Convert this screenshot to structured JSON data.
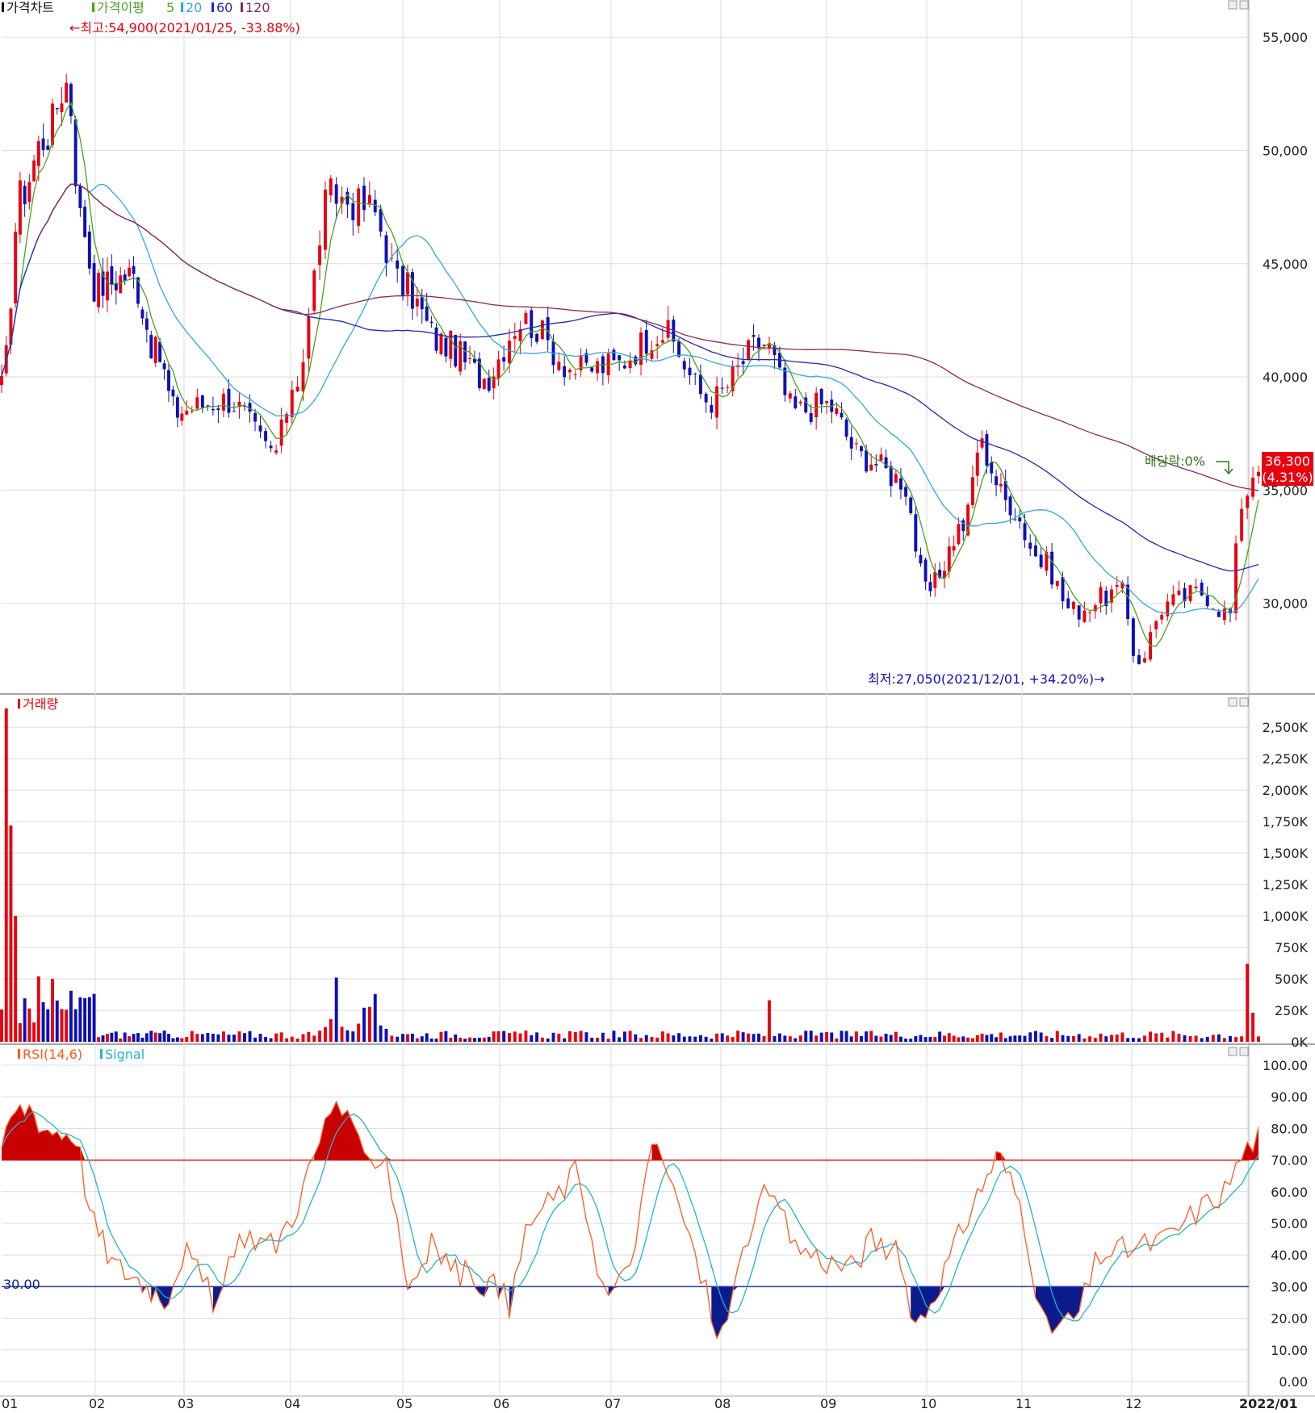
{
  "colors": {
    "up": "#e8000f",
    "down": "#0d10b4",
    "ma5": "#4aa21e",
    "ma20": "#33a6df",
    "ma60": "#2228b8",
    "ma120": "#8a2a54",
    "rsi": "#ff5a1f",
    "signal": "#23b4c8",
    "over": "#c80000",
    "under": "#0b1b8c",
    "grid": "#dcdcdc",
    "axis": "#777777",
    "text": "#222222"
  },
  "months": [
    "01",
    "02",
    "03",
    "04",
    "05",
    "06",
    "07",
    "08",
    "09",
    "10",
    "11",
    "12",
    "2022/01"
  ],
  "price_panel": {
    "legend": {
      "chart": "가격차트",
      "ma": "가격이평",
      "p5": "5",
      "p20": "20",
      "p60": "60",
      "p120": "120"
    },
    "high_label": "←최고:54,900(2021/01/25, -33.88%)",
    "low_label": "최저:27,050(2021/12/01, +34.20%)→",
    "dividend_label": "배당락:0%",
    "last_price": "36,300",
    "last_change": "(4.31%)",
    "ticks": [
      "55,000",
      "50,000",
      "45,000",
      "40,000",
      "35,000",
      "30,000"
    ]
  },
  "volume_panel": {
    "legend": "거래량",
    "ticks": [
      "2,500K",
      "2,250K",
      "2,000K",
      "1,750K",
      "1,500K",
      "1,250K",
      "1,000K",
      "750K",
      "500K",
      "250K",
      "0K"
    ]
  },
  "rsi_panel": {
    "legend_rsi": "RSI(14,6)",
    "legend_signal": "Signal",
    "ticks": [
      "100.00",
      "90.00",
      "80.00",
      "70.00",
      "60.00",
      "50.00",
      "40.00",
      "30.00",
      "20.00",
      "10.00",
      "0.00"
    ],
    "lower_label": "30.00"
  },
  "chart_data": [
    {
      "type": "candlestick",
      "title": "가격차트",
      "x_axis": "month",
      "ylim": [
        26000,
        56500
      ],
      "high": {
        "value": 54900,
        "date": "2021/01/25",
        "change_pct": -33.88
      },
      "low": {
        "value": 27050,
        "date": "2021/12/01",
        "change_pct": 34.2
      },
      "last": {
        "value": 36300,
        "change_pct": 4.31
      },
      "close_path": [
        {
          "month": 1.0,
          "close": 39500
        },
        {
          "month": 1.2,
          "close": 48000
        },
        {
          "month": 1.45,
          "close": 50500
        },
        {
          "month": 1.7,
          "close": 53000
        },
        {
          "month": 1.85,
          "close": 47000
        },
        {
          "month": 2.0,
          "close": 44000
        },
        {
          "month": 2.4,
          "close": 44500
        },
        {
          "month": 2.7,
          "close": 41000
        },
        {
          "month": 2.9,
          "close": 38500
        },
        {
          "month": 3.4,
          "close": 39000
        },
        {
          "month": 3.85,
          "close": 36700
        },
        {
          "month": 4.05,
          "close": 40000
        },
        {
          "month": 4.35,
          "close": 48000
        },
        {
          "month": 4.7,
          "close": 47500
        },
        {
          "month": 5.0,
          "close": 44000
        },
        {
          "month": 5.4,
          "close": 41500
        },
        {
          "month": 5.85,
          "close": 40000
        },
        {
          "month": 6.2,
          "close": 42500
        },
        {
          "month": 6.7,
          "close": 40300
        },
        {
          "month": 7.0,
          "close": 40500
        },
        {
          "month": 7.45,
          "close": 42000
        },
        {
          "month": 7.9,
          "close": 39000
        },
        {
          "month": 8.4,
          "close": 41500
        },
        {
          "month": 8.7,
          "close": 38500
        },
        {
          "month": 9.0,
          "close": 38800
        },
        {
          "month": 9.35,
          "close": 36500
        },
        {
          "month": 9.75,
          "close": 35500
        },
        {
          "month": 10.0,
          "close": 30500
        },
        {
          "month": 10.4,
          "close": 33500
        },
        {
          "month": 10.55,
          "close": 37000
        },
        {
          "month": 10.85,
          "close": 34500
        },
        {
          "month": 11.2,
          "close": 31800
        },
        {
          "month": 11.45,
          "close": 29700
        },
        {
          "month": 11.9,
          "close": 30500
        },
        {
          "month": 12.05,
          "close": 27500
        },
        {
          "month": 12.3,
          "close": 30000
        },
        {
          "month": 12.6,
          "close": 30500
        },
        {
          "month": 12.85,
          "close": 29500
        },
        {
          "month": 12.95,
          "close": 34500
        },
        {
          "month": 13.1,
          "close": 36300
        }
      ],
      "moving_averages": [
        {
          "name": "5"
        },
        {
          "name": "20"
        },
        {
          "name": "60"
        },
        {
          "name": "120"
        }
      ]
    },
    {
      "type": "bar",
      "title": "거래량",
      "unit": "K",
      "ylim": [
        0,
        2700
      ],
      "notable": [
        {
          "month": 1.05,
          "value": 2650
        },
        {
          "month": 1.1,
          "value": 1720
        },
        {
          "month": 1.15,
          "value": 1000
        },
        {
          "month": 1.4,
          "value": 520
        },
        {
          "month": 1.55,
          "value": 500
        },
        {
          "month": 4.4,
          "value": 510
        },
        {
          "month": 4.75,
          "value": 380
        },
        {
          "month": 8.45,
          "value": 330
        },
        {
          "month": 13.0,
          "value": 620
        },
        {
          "month": 13.05,
          "value": 230
        }
      ],
      "baseline": 60
    },
    {
      "type": "line",
      "title": "RSI(14,6)",
      "ylim": [
        0,
        100
      ],
      "upper_band": 70,
      "lower_band": 30,
      "series": [
        {
          "name": "RSI(14,6)",
          "points": [
            {
              "month": 1.0,
              "value": 70
            },
            {
              "month": 1.1,
              "value": 84
            },
            {
              "month": 1.3,
              "value": 87
            },
            {
              "month": 1.45,
              "value": 80
            },
            {
              "month": 1.8,
              "value": 78
            },
            {
              "month": 1.95,
              "value": 52
            },
            {
              "month": 2.2,
              "value": 37
            },
            {
              "month": 2.5,
              "value": 32
            },
            {
              "month": 2.8,
              "value": 26
            },
            {
              "month": 3.0,
              "value": 42
            },
            {
              "month": 3.3,
              "value": 24
            },
            {
              "month": 3.55,
              "value": 47
            },
            {
              "month": 3.85,
              "value": 43
            },
            {
              "month": 4.05,
              "value": 55
            },
            {
              "month": 4.4,
              "value": 90
            },
            {
              "month": 4.65,
              "value": 70
            },
            {
              "month": 4.85,
              "value": 72
            },
            {
              "month": 5.05,
              "value": 30
            },
            {
              "month": 5.3,
              "value": 43
            },
            {
              "month": 5.55,
              "value": 35
            },
            {
              "month": 5.95,
              "value": 30
            },
            {
              "month": 6.1,
              "value": 24
            },
            {
              "month": 6.25,
              "value": 50
            },
            {
              "month": 6.55,
              "value": 60
            },
            {
              "month": 6.7,
              "value": 67
            },
            {
              "month": 6.95,
              "value": 26
            },
            {
              "month": 7.15,
              "value": 34
            },
            {
              "month": 7.4,
              "value": 77
            },
            {
              "month": 7.65,
              "value": 52
            },
            {
              "month": 8.0,
              "value": 13
            },
            {
              "month": 8.3,
              "value": 52
            },
            {
              "month": 8.45,
              "value": 60
            },
            {
              "month": 8.7,
              "value": 43
            },
            {
              "month": 9.0,
              "value": 38
            },
            {
              "month": 9.25,
              "value": 36
            },
            {
              "month": 9.45,
              "value": 45
            },
            {
              "month": 9.7,
              "value": 40
            },
            {
              "month": 9.9,
              "value": 18
            },
            {
              "month": 10.05,
              "value": 26
            },
            {
              "month": 10.2,
              "value": 36
            },
            {
              "month": 10.5,
              "value": 57
            },
            {
              "month": 10.75,
              "value": 72
            },
            {
              "month": 11.0,
              "value": 55
            },
            {
              "month": 11.2,
              "value": 16
            },
            {
              "month": 11.5,
              "value": 20
            },
            {
              "month": 11.7,
              "value": 40
            },
            {
              "month": 12.0,
              "value": 42
            },
            {
              "month": 12.3,
              "value": 45
            },
            {
              "month": 12.6,
              "value": 55
            },
            {
              "month": 12.8,
              "value": 60
            },
            {
              "month": 12.95,
              "value": 71
            },
            {
              "month": 13.05,
              "value": 76
            },
            {
              "month": 13.15,
              "value": 78
            }
          ]
        },
        {
          "name": "Signal"
        }
      ]
    }
  ]
}
